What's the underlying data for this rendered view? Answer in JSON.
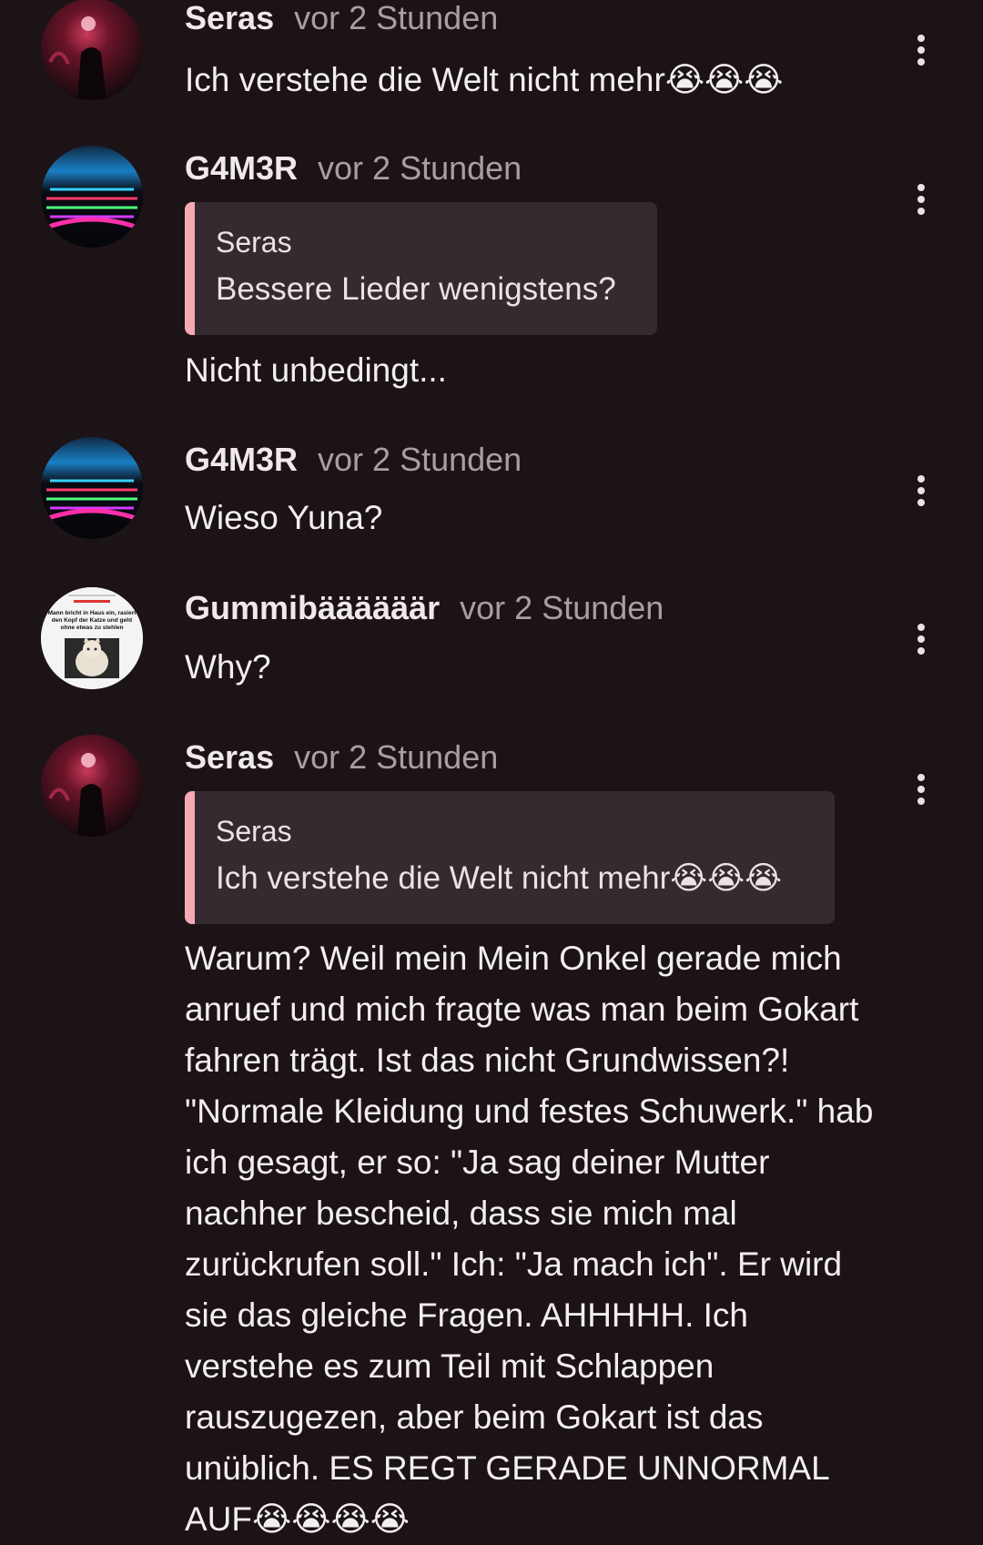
{
  "colors": {
    "background": "#1c1317",
    "quote_background": "#342a2f",
    "quote_accent": "#f5a9b3",
    "secondary_text": "#a89ea3"
  },
  "comments": [
    {
      "author": "Seras",
      "time": "vor 2 Stunden",
      "text": "Ich verstehe die Welt nicht mehr😭😭😭",
      "avatar": "dark-red-avatar"
    },
    {
      "author": "G4M3R",
      "time": "vor 2 Stunden",
      "quote": {
        "author": "Seras",
        "text": "Bessere Lieder wenigstens?"
      },
      "text": "Nicht unbedingt...",
      "avatar": "rgb-keyboard-avatar"
    },
    {
      "author": "G4M3R",
      "time": "vor 2 Stunden",
      "text": "Wieso Yuna?",
      "avatar": "rgb-keyboard-avatar"
    },
    {
      "author": "Gummibäääääär",
      "time": "vor 2 Stunden",
      "text": "Why?",
      "avatar": "news-cat-avatar",
      "avatar_caption": "Mann bricht in Haus ein, rasiert den Kopf der Katze und geht ohne etwas zu stehlen"
    },
    {
      "author": "Seras",
      "time": "vor 2 Stunden",
      "quote": {
        "author": "Seras",
        "text": "Ich verstehe die Welt nicht mehr😭😭😭"
      },
      "text": "Warum? Weil mein Mein Onkel gerade mich anruef und mich fragte was man beim Gokart fahren trägt. Ist das nicht Grundwissen?! \"Normale Kleidung und festes Schuwerk.\" hab ich gesagt, er so: \"Ja sag deiner Mutter nachher bescheid, dass sie mich mal zurückrufen soll.\" Ich: \"Ja mach ich\". Er wird sie das gleiche Fragen. AHHHHH. Ich verstehe es zum Teil mit Schlappen rauszugezen, aber beim Gokart ist das unüblich. ES REGT GERADE UNNORMAL AUF😭😭😭😭",
      "avatar": "dark-red-avatar"
    }
  ]
}
